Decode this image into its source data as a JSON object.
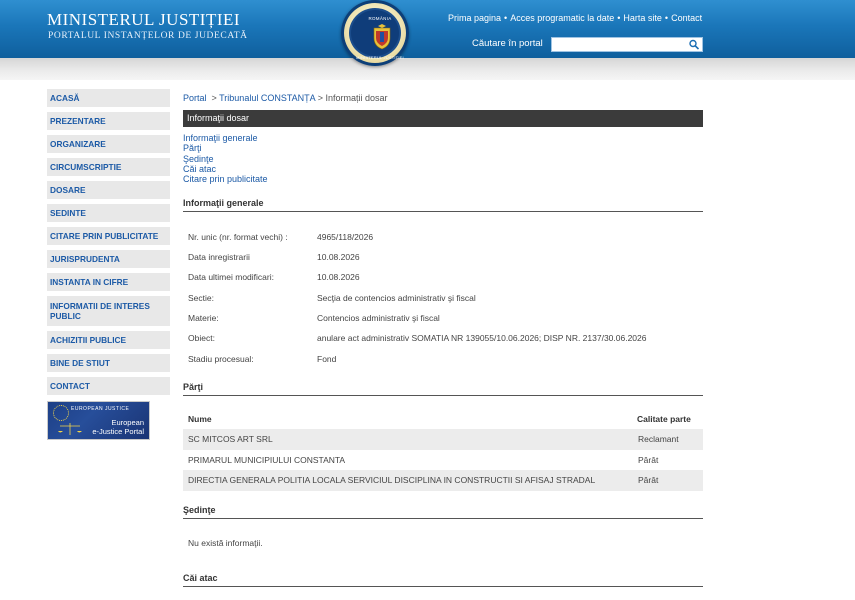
{
  "header": {
    "title": "MINISTERUL JUSTIȚIEI",
    "subtitle": "PORTALUL INSTANȚELOR DE JUDECATĂ",
    "seal_top": "ROMÂNIA",
    "seal_bottom": "MINISTERUL JUSTIȚIEI",
    "links": [
      "Prima pagina",
      "Acces programatic la date",
      "Harta site",
      "Contact"
    ],
    "separator": "•",
    "search_label": "Căutare în portal",
    "search_value": ""
  },
  "sidebar": {
    "items": [
      "ACASĂ",
      "PREZENTARE",
      "ORGANIZARE",
      "CIRCUMSCRIPTIE",
      "DOSARE",
      "SEDINTE",
      "CITARE PRIN PUBLICITATE",
      "JURISPRUDENTA",
      "INSTANTA IN CIFRE",
      "INFORMATII DE INTERES PUBLIC",
      "ACHIZITII PUBLICE",
      "BINE DE STIUT",
      "CONTACT"
    ],
    "ejustice": {
      "eu": "EUROPEAN JUSTICE",
      "line1": "European",
      "line2": "e-Justice Portal"
    }
  },
  "breadcrumb": {
    "portal": "Portal",
    "sep": ">",
    "court": "Tribunalul CONSTANȚA",
    "current": "Informații dosar"
  },
  "panel_title": "Informaţii dosar",
  "anchors": [
    "Informaţii generale",
    "Părţi",
    "Şedinţe",
    "Căi atac",
    "Citare prin publicitate"
  ],
  "general": {
    "heading": "Informaţii generale",
    "rows": [
      {
        "label": "Nr. unic (nr. format vechi) :",
        "value": "4965/118/2026"
      },
      {
        "label": "Data inregistrarii",
        "value": "10.08.2026"
      },
      {
        "label": "Data ultimei modificari:",
        "value": "10.08.2026"
      },
      {
        "label": "Sectie:",
        "value": "Secţia de contencios administrativ şi fiscal"
      },
      {
        "label": "Materie:",
        "value": "Contencios administrativ şi fiscal"
      },
      {
        "label": "Obiect:",
        "value": "anulare act administrativ SOMATIA NR 139055/10.06.2026; DISP NR. 2137/30.06.2026"
      },
      {
        "label": "Stadiu procesual:",
        "value": "Fond"
      }
    ]
  },
  "parti": {
    "heading": "Părţi",
    "col_name": "Nume",
    "col_role": "Calitate parte",
    "rows": [
      {
        "name": "SC MITCOS ART SRL",
        "role": "Reclamant"
      },
      {
        "name": "PRIMARUL MUNICIPIULUI CONSTANTA",
        "role": "Pârât"
      },
      {
        "name": "DIRECTIA GENERALA POLITIA LOCALA SERVICIUL DISCIPLINA IN CONSTRUCTII SI AFISAJ STRADAL",
        "role": "Pârât"
      }
    ]
  },
  "sedinte": {
    "heading": "Şedinţe",
    "empty": "Nu există informaţii."
  },
  "cai_atac": {
    "heading": "Căi atac"
  }
}
